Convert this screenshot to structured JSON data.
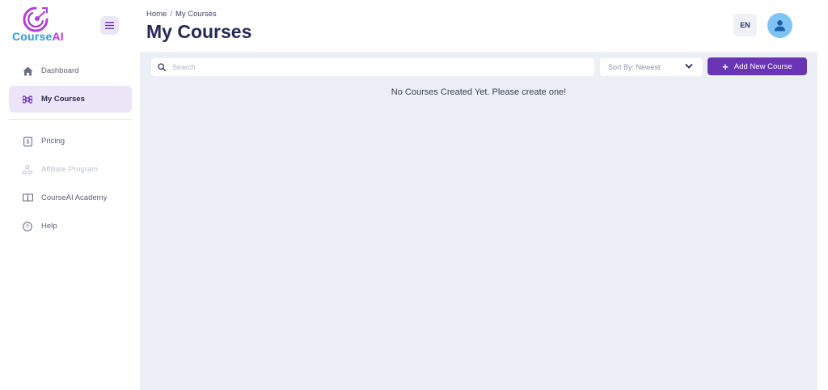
{
  "brand": {
    "name_part1": "Course",
    "name_part2": "AI",
    "colors": {
      "blue": "#2a9fd6",
      "purple": "#b23fd8"
    }
  },
  "sidebar": {
    "toggle_icon": "hamburger-icon",
    "items": [
      {
        "label": "Dashboard",
        "icon": "home-icon",
        "state": "normal"
      },
      {
        "label": "My Courses",
        "icon": "command-icon",
        "state": "active"
      },
      {
        "label": "Pricing",
        "icon": "dollar-icon",
        "state": "normal"
      },
      {
        "label": "Affiliate Program",
        "icon": "people-icon",
        "state": "disabled"
      },
      {
        "label": "CourseAI Academy",
        "icon": "book-icon",
        "state": "normal"
      },
      {
        "label": "Help",
        "icon": "help-icon",
        "state": "normal"
      }
    ]
  },
  "header": {
    "breadcrumb": {
      "home": "Home",
      "separator": "/",
      "current": "My Courses"
    },
    "title": "My Courses",
    "language": "EN"
  },
  "toolbar": {
    "search_placeholder": "Search",
    "sort_label": "Sort By: Newest",
    "add_button_label": "Add New Course"
  },
  "main": {
    "empty_message": "No Courses Created Yet. Please create one!"
  },
  "colors": {
    "accent": "#6a35b5",
    "active_bg": "#ece4f7",
    "content_bg": "#eceff5",
    "avatar": "#7fc4f2"
  }
}
